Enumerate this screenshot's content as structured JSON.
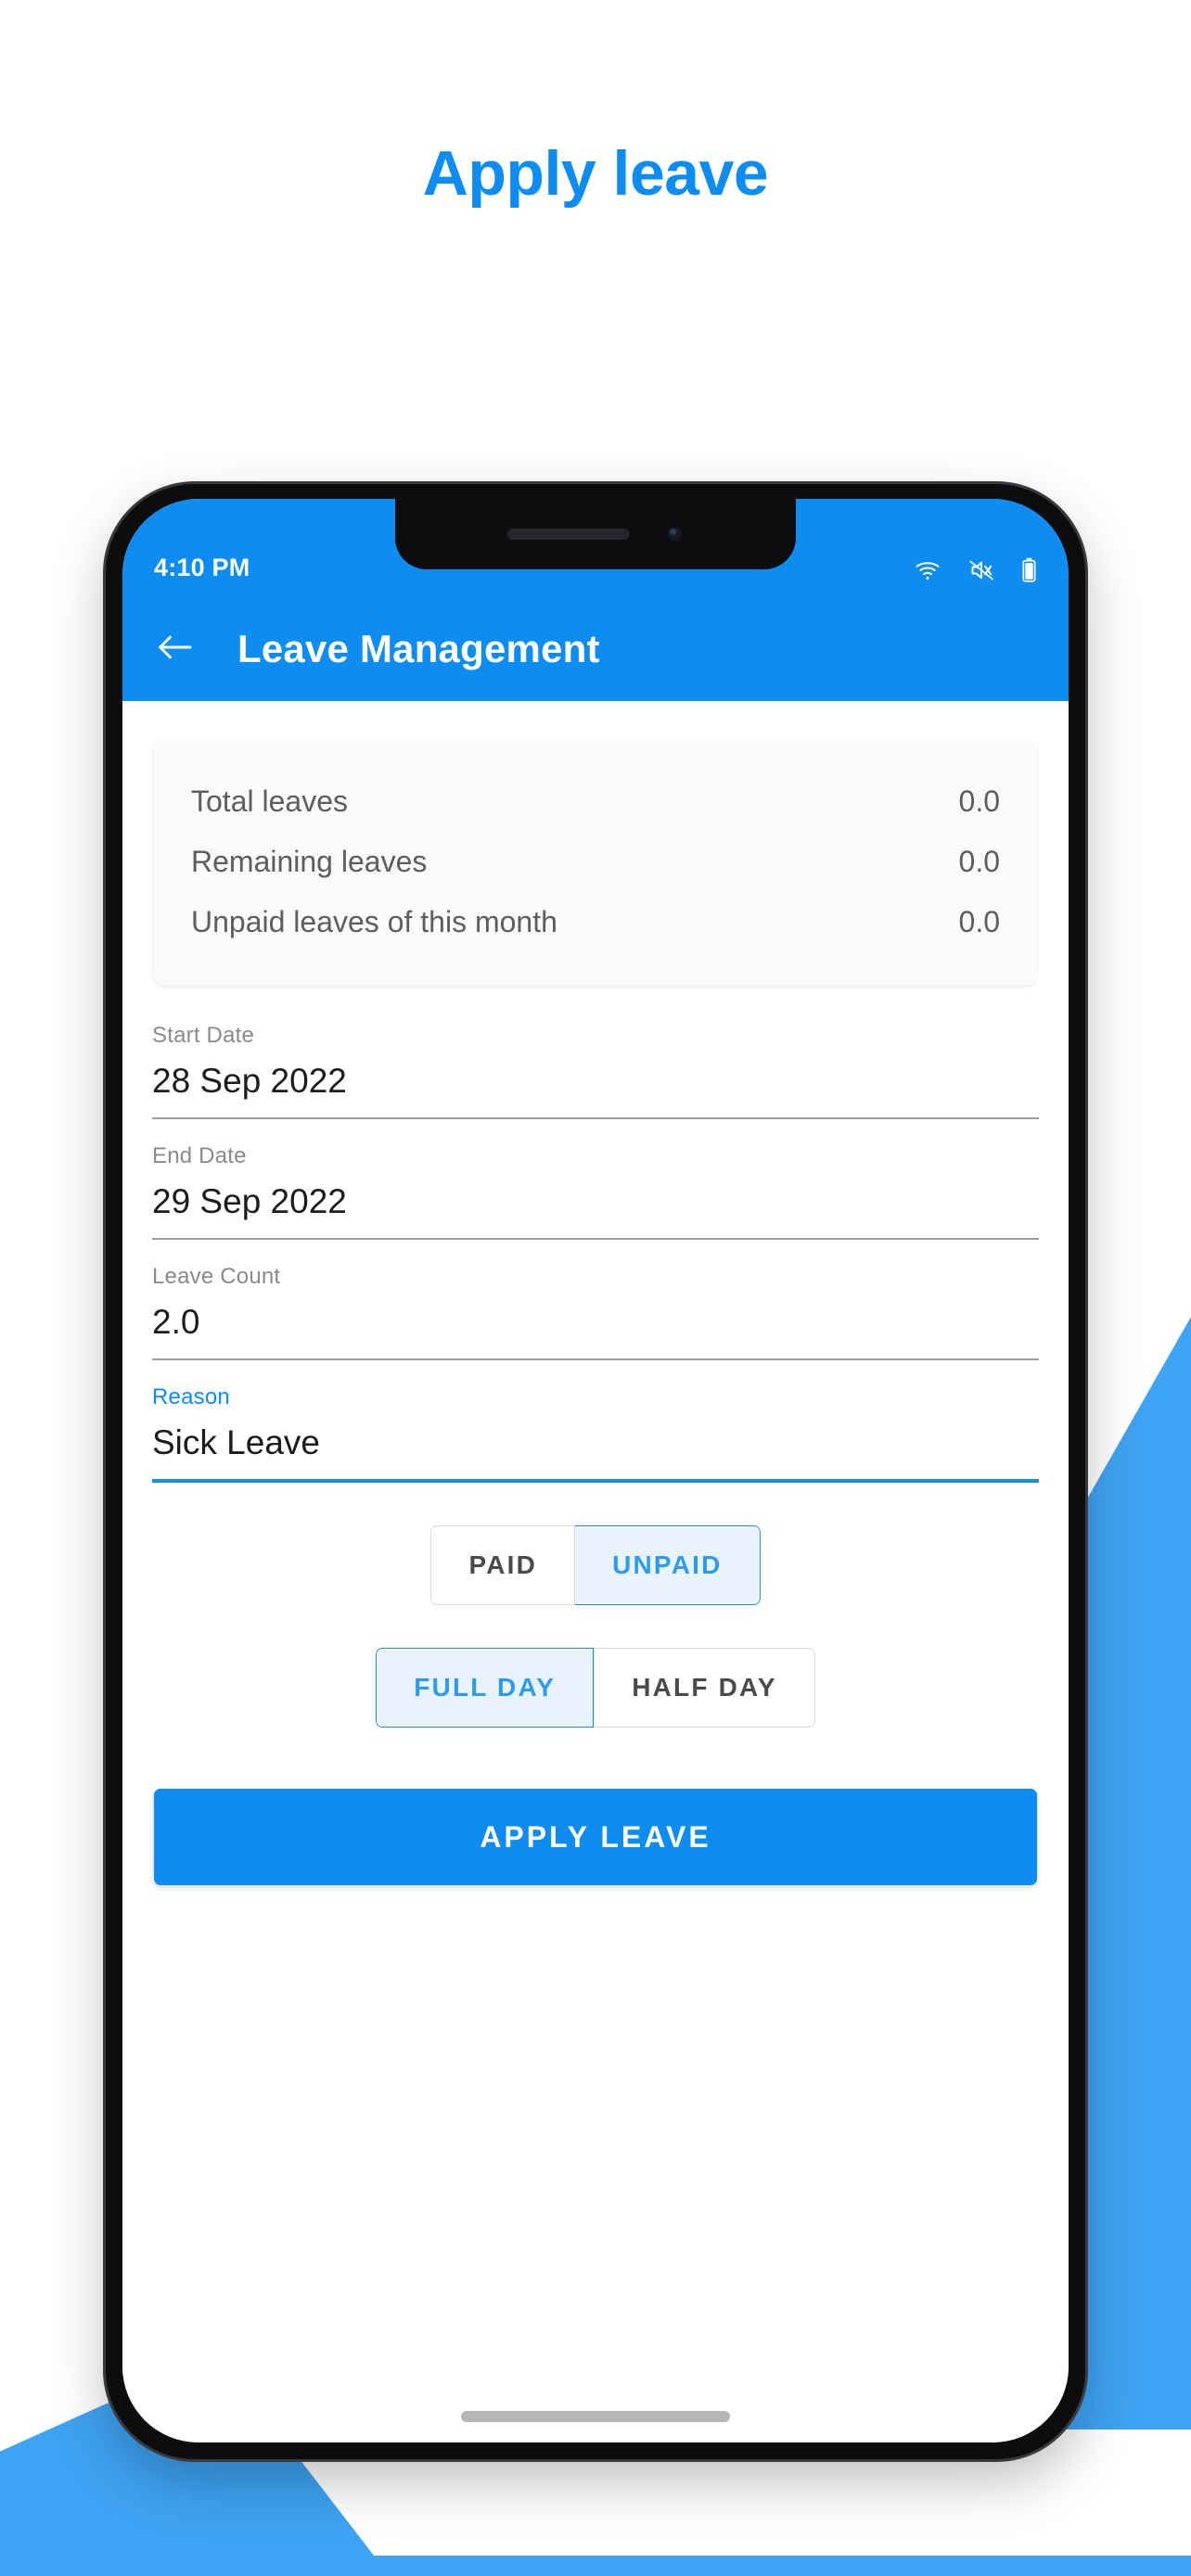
{
  "headline": "Apply leave",
  "theme": {
    "primary_blue": "#0d8cf2",
    "decor_blue": "#3ea3f2",
    "accent_selected_bg": "#e8f3fd",
    "accent_selected_text": "#2d9cf0",
    "muted_text": "#8a8a8a"
  },
  "status_bar": {
    "time": "4:10 PM",
    "icons": [
      "wifi-icon",
      "volume-mute-icon",
      "battery-icon"
    ]
  },
  "app_bar": {
    "back_icon": "arrow-left-icon",
    "title": "Leave Management"
  },
  "summary_card": {
    "rows": [
      {
        "label": "Total leaves",
        "value": "0.0"
      },
      {
        "label": "Remaining leaves",
        "value": "0.0"
      },
      {
        "label": "Unpaid leaves of this month",
        "value": "0.0"
      }
    ]
  },
  "form": {
    "start_date": {
      "label": "Start Date",
      "value": "28 Sep 2022"
    },
    "end_date": {
      "label": "End Date",
      "value": "29 Sep 2022"
    },
    "leave_count": {
      "label": "Leave Count",
      "value": "2.0"
    },
    "reason": {
      "label": "Reason",
      "value": "Sick Leave",
      "focused": true
    }
  },
  "pay_toggle": {
    "options": [
      "PAID",
      "UNPAID"
    ],
    "selected": "UNPAID"
  },
  "duration_toggle": {
    "options": [
      "FULL DAY",
      "HALF DAY"
    ],
    "selected": "FULL DAY"
  },
  "apply_button": {
    "label": "APPLY LEAVE"
  }
}
